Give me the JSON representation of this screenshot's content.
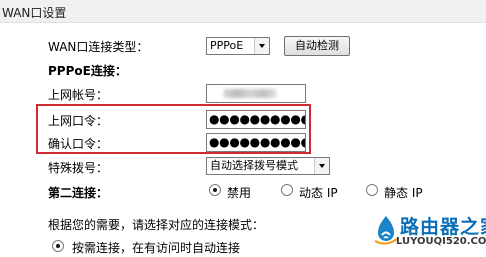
{
  "title": "WAN口设置",
  "wan_type": {
    "label": "WAN口连接类型：",
    "value": "PPPoE",
    "detect_button": "自动检测"
  },
  "pppoe": {
    "section_label": "PPPoE连接：",
    "account_label": "上网帐号：",
    "password_label": "上网口令：",
    "password_value": "●●●●●●●●●●●●●",
    "confirm_label": "确认口令：",
    "confirm_value": "●●●●●●●●●●●●●"
  },
  "dial": {
    "label": "特殊拨号：",
    "value": "自动选择拨号模式"
  },
  "second_conn": {
    "label": "第二连接：",
    "options": [
      {
        "label": "禁用",
        "selected": true
      },
      {
        "label": "动态 IP",
        "selected": false
      },
      {
        "label": "静态 IP",
        "selected": false
      }
    ]
  },
  "mode": {
    "prompt": "根据您的需要，请选择对应的连接模式：",
    "option1": "按需连接，在有访问时自动连接"
  },
  "watermark": {
    "text": "路由器之家",
    "url": "LUYOUQI520.COM",
    "color": "#0b6fb8"
  },
  "highlight_color": "#cf2b33"
}
